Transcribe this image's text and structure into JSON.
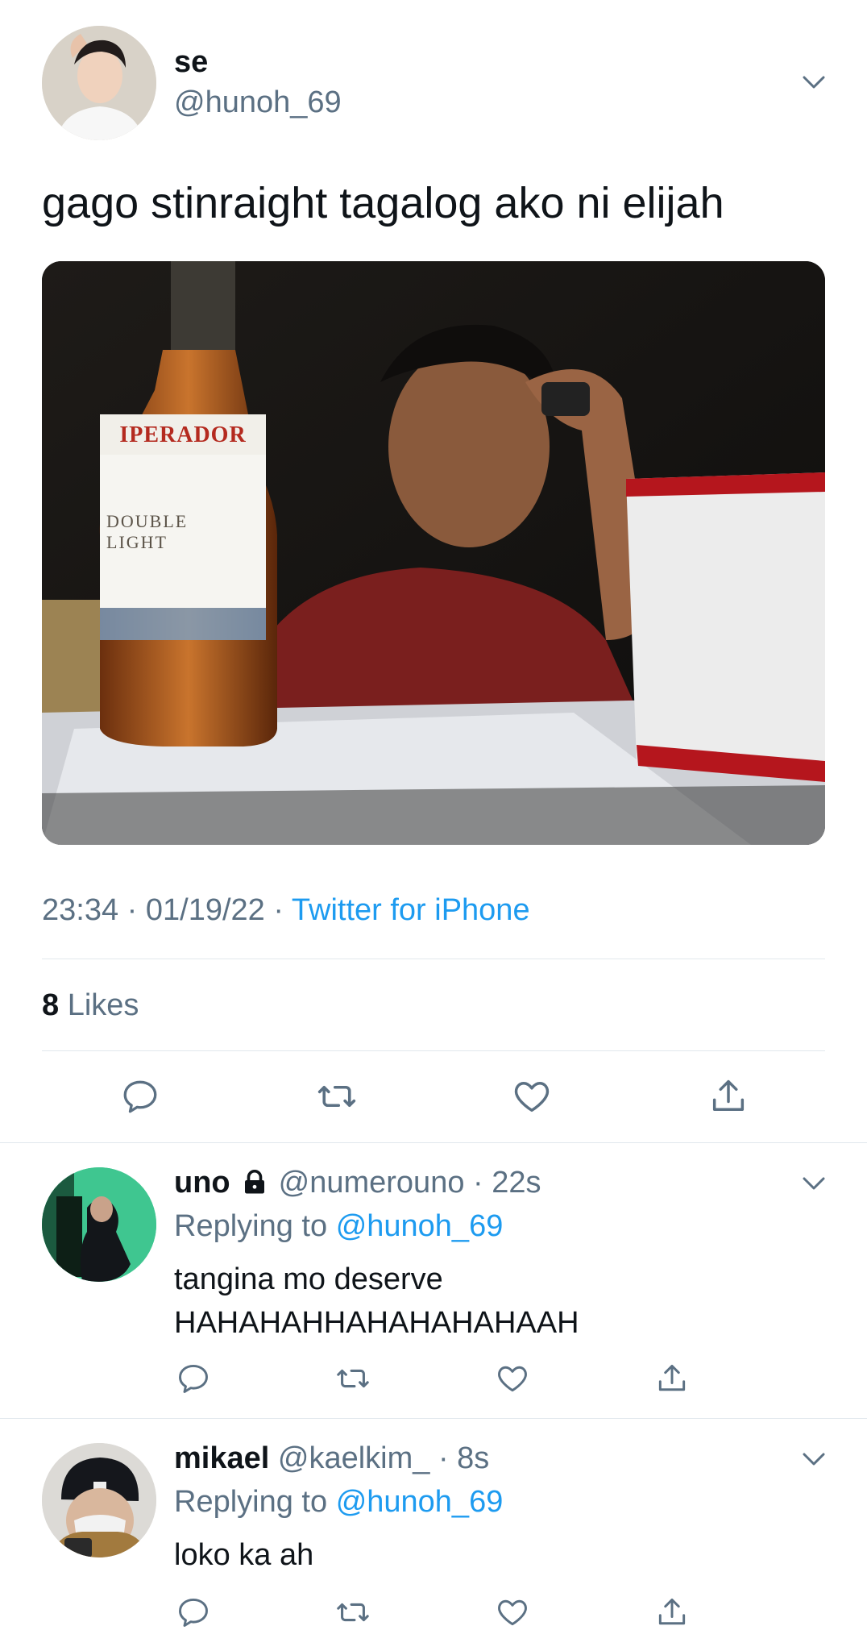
{
  "tweet": {
    "author_name": "se",
    "author_handle": "@hunoh_69",
    "text": "gago stinraight tagalog ako ni elijah",
    "time": "23:34",
    "date": "01/19/22",
    "source": "Twitter for iPhone",
    "likes_count": "8",
    "likes_label": "Likes",
    "photo_label_brand": "IPERADOR",
    "photo_label_line1": "DOUBLE",
    "photo_label_line2": "LIGHT"
  },
  "replies": [
    {
      "name": "uno",
      "handle": "@numerouno",
      "time": "22s",
      "replying_prefix": "Replying to",
      "replying_handle": "@hunoh_69",
      "text_line1": "tangina mo deserve",
      "text_line2": "HAHAHAHHAHAHAHAHAAH"
    },
    {
      "name": "mikael",
      "handle": "@kaelkim_",
      "time": "8s",
      "replying_prefix": "Replying to",
      "replying_handle": "@hunoh_69",
      "text_line1": "loko ka ah"
    }
  ],
  "colors": {
    "link": "#1d9bf0",
    "muted": "#5b7083",
    "divider": "#e1e8ed"
  }
}
